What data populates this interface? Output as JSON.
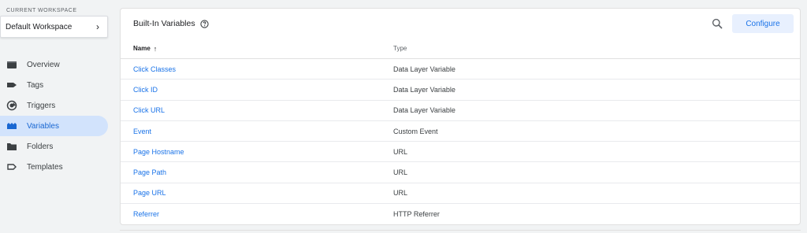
{
  "workspace": {
    "section_label": "CURRENT WORKSPACE",
    "name": "Default Workspace",
    "chevron": "›"
  },
  "nav": {
    "items": [
      {
        "label": "Overview",
        "icon": "overview-icon",
        "active": false
      },
      {
        "label": "Tags",
        "icon": "tag-icon",
        "active": false
      },
      {
        "label": "Triggers",
        "icon": "trigger-icon",
        "active": false
      },
      {
        "label": "Variables",
        "icon": "variables-icon",
        "active": true
      },
      {
        "label": "Folders",
        "icon": "folder-icon",
        "active": false
      },
      {
        "label": "Templates",
        "icon": "template-icon",
        "active": false
      }
    ]
  },
  "panel": {
    "title": "Built-In Variables",
    "configure_label": "Configure",
    "columns": {
      "name": "Name",
      "type": "Type"
    },
    "sort_arrow": "↑",
    "rows": [
      {
        "name": "Click Classes",
        "type": "Data Layer Variable"
      },
      {
        "name": "Click ID",
        "type": "Data Layer Variable"
      },
      {
        "name": "Click URL",
        "type": "Data Layer Variable"
      },
      {
        "name": "Event",
        "type": "Custom Event"
      },
      {
        "name": "Page Hostname",
        "type": "URL"
      },
      {
        "name": "Page Path",
        "type": "URL"
      },
      {
        "name": "Page URL",
        "type": "URL"
      },
      {
        "name": "Referrer",
        "type": "HTTP Referrer"
      }
    ]
  },
  "colors": {
    "accent": "#1a73e8",
    "active_bg": "#d2e3fc",
    "background": "#f1f3f4"
  }
}
